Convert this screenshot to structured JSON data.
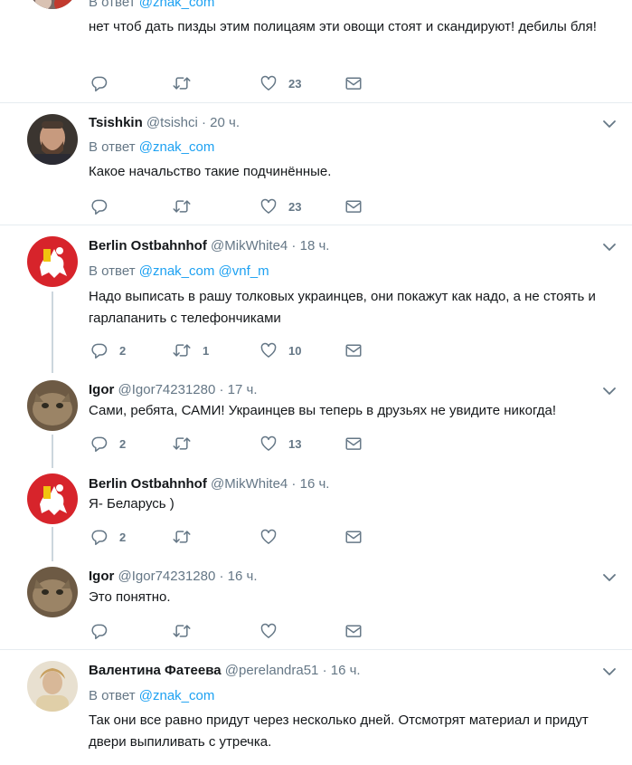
{
  "tweets": [
    {
      "reply_prefix": "В ответ",
      "reply_to": [
        "@znak_com"
      ],
      "text": "нет чтоб дать пизды этим полицаям эти овощи стоят и скандируют! дебилы бля!",
      "replies": "",
      "retweets": "",
      "likes": "23"
    },
    {
      "name": "Tsishkin",
      "handle": "@tsishci",
      "time": "20 ч.",
      "reply_prefix": "В ответ",
      "reply_to": [
        "@znak_com"
      ],
      "text": "Какое начальство такие подчинённые.",
      "replies": "",
      "retweets": "",
      "likes": "23"
    },
    {
      "name": "Berlin Ostbahnhof",
      "handle": "@MikWhite4",
      "time": "18 ч.",
      "reply_prefix": "В ответ",
      "reply_to": [
        "@znak_com",
        "@vnf_m"
      ],
      "text": "Надо выписать в рашу толковых украинцев, они покажут как надо, а не стоять и гарлапанить с телефончиками",
      "replies": "2",
      "retweets": "1",
      "likes": "10"
    },
    {
      "name": "Igor",
      "handle": "@Igor74231280",
      "time": "17 ч.",
      "text": "Сами, ребята, САМИ! Украинцев вы теперь в друзьях не увидите никогда!",
      "replies": "2",
      "retweets": "",
      "likes": "13"
    },
    {
      "name": "Berlin Ostbahnhof",
      "handle": "@MikWhite4",
      "time": "16 ч.",
      "text": "Я- Беларусь )",
      "replies": "2",
      "retweets": "",
      "likes": ""
    },
    {
      "name": "Igor",
      "handle": "@Igor74231280",
      "time": "16 ч.",
      "text": "Это понятно.",
      "replies": "",
      "retweets": "",
      "likes": ""
    },
    {
      "name": "Валентина Фатеева",
      "handle": "@perelandra51",
      "time": "16 ч.",
      "reply_prefix": "В ответ",
      "reply_to": [
        "@znak_com"
      ],
      "text": "Так они все равно придут через несколько дней. Отсмотрят материал и придут двери выпиливать с утречка."
    }
  ],
  "colors": {
    "accent": "#1da1f2",
    "muted": "#657786",
    "separator": "#e6ecf0",
    "thread": "#ccd6dd"
  },
  "icons": [
    "reply-icon",
    "retweet-icon",
    "like-icon",
    "dm-icon",
    "chevron-down-icon"
  ]
}
